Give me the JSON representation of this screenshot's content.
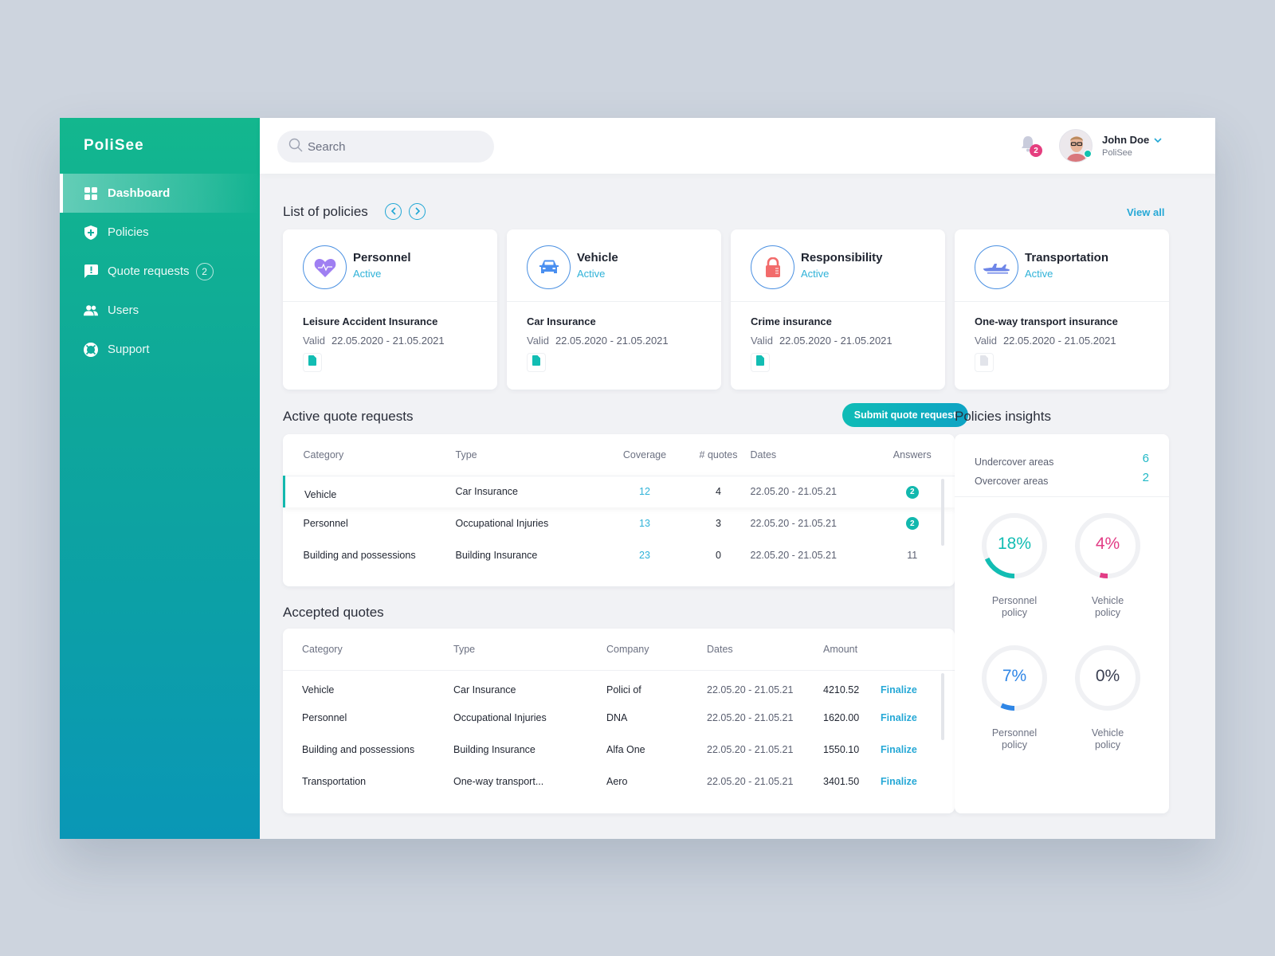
{
  "app": {
    "brand": "PoliSee"
  },
  "sidebar": {
    "items": [
      {
        "label": "Dashboard",
        "icon": "dashboard-grid-icon",
        "active": true
      },
      {
        "label": "Policies",
        "icon": "shield-plus-icon"
      },
      {
        "label": "Quote requests",
        "icon": "alert-message-icon",
        "badge": "2"
      },
      {
        "label": "Users",
        "icon": "users-icon"
      },
      {
        "label": "Support",
        "icon": "lifebuoy-icon"
      }
    ]
  },
  "header": {
    "search_placeholder": "Search",
    "notifications_count": "2",
    "user": {
      "name": "John Doe",
      "company": "PoliSee",
      "status": "online"
    }
  },
  "policies": {
    "title": "List of policies",
    "view_all": "View all",
    "cards": [
      {
        "category": "Personnel",
        "status": "Active",
        "icon": "heart-pulse-icon",
        "name": "Leisure Accident Insurance",
        "valid_label": "Valid",
        "dates": "22.05.2020 - 21.05.2021",
        "doc_active": true
      },
      {
        "category": "Vehicle",
        "status": "Active",
        "icon": "car-icon",
        "name": "Car Insurance",
        "valid_label": "Valid",
        "dates": "22.05.2020 - 21.05.2021",
        "doc_active": true
      },
      {
        "category": "Responsibility",
        "status": "Active",
        "icon": "padlock-icon",
        "name": "Crime insurance",
        "valid_label": "Valid",
        "dates": "22.05.2020 - 21.05.2021",
        "doc_active": true
      },
      {
        "category": "Transportation",
        "status": "Active",
        "icon": "airplane-icon",
        "name": "One-way transport insurance",
        "valid_label": "Valid",
        "dates": "22.05.2020 - 21.05.2021",
        "doc_active": false
      }
    ]
  },
  "quote_requests": {
    "title": "Active quote requests",
    "submit_label": "Submit quote request",
    "columns": [
      "Category",
      "Type",
      "Coverage",
      "# quotes",
      "Dates",
      "Answers"
    ],
    "rows": [
      {
        "category": "Vehicle",
        "type": "Car Insurance",
        "coverage": "12",
        "quotes": "4",
        "dates": "22.05.20 - 21.05.21",
        "answers": "2",
        "answers_badge": true,
        "selected": true
      },
      {
        "category": "Personnel",
        "type": "Occupational Injuries",
        "coverage": "13",
        "quotes": "3",
        "dates": "22.05.20 - 21.05.21",
        "answers": "2",
        "answers_badge": true
      },
      {
        "category": "Building and possessions",
        "type": "Building Insurance",
        "coverage": "23",
        "quotes": "0",
        "dates": "22.05.20 - 21.05.21",
        "answers": "11",
        "answers_badge": false
      }
    ]
  },
  "accepted_quotes": {
    "title": "Accepted quotes",
    "columns": [
      "Category",
      "Type",
      "Company",
      "Dates",
      "Amount",
      ""
    ],
    "action_label": "Finalize",
    "rows": [
      {
        "category": "Vehicle",
        "type": "Car Insurance",
        "company": "Polici of",
        "dates": "22.05.20 - 21.05.21",
        "amount": "4210.52"
      },
      {
        "category": "Personnel",
        "type": "Occupational Injuries",
        "company": "DNA",
        "dates": "22.05.20 - 21.05.21",
        "amount": "1620.00"
      },
      {
        "category": "Building and possessions",
        "type": "Building Insurance",
        "company": "Alfa One",
        "dates": "22.05.20 - 21.05.21",
        "amount": "1550.10"
      },
      {
        "category": "Transportation",
        "type": "One-way transport...",
        "company": "Aero",
        "dates": "22.05.20 - 21.05.21",
        "amount": "3401.50"
      }
    ]
  },
  "insights": {
    "title": "Policies insights",
    "stats": [
      {
        "label": "Undercover areas",
        "value": "6"
      },
      {
        "label": "Overcover areas",
        "value": "2"
      }
    ],
    "donuts": [
      {
        "pct_label": "18%",
        "value": 18,
        "color": "#12bdb3",
        "label_line1": "Personnel",
        "label_line2": "policy"
      },
      {
        "pct_label": "4%",
        "value": 4,
        "color": "#e23d86",
        "label_line1": "Vehicle",
        "label_line2": "policy"
      },
      {
        "pct_label": "7%",
        "value": 7,
        "color": "#2f86e6",
        "label_line1": "Personnel",
        "label_line2": "policy"
      },
      {
        "pct_label": "0%",
        "value": 0,
        "color": "#3a3f52",
        "label_line1": "Vehicle",
        "label_line2": "policy"
      }
    ]
  },
  "colors": {
    "accent": "#12b8ae",
    "link": "#26a8d6",
    "badge": "#e53e7f"
  }
}
